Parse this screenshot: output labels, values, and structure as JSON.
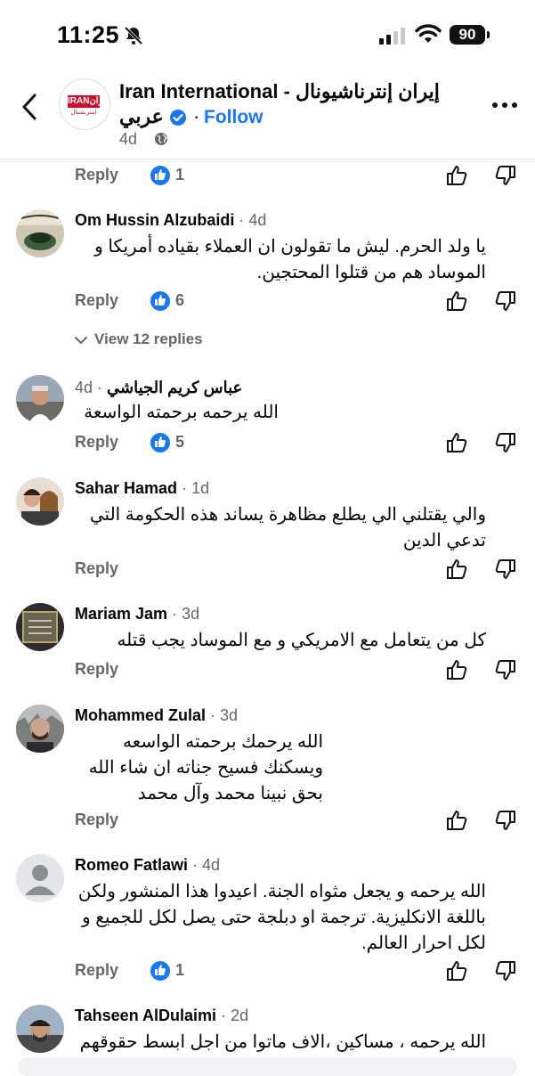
{
  "status_bar": {
    "time": "11:25",
    "battery": "90"
  },
  "header": {
    "page_name_line1": "Iran International - إيران إنترناشيونال",
    "page_name_line2": "عربي",
    "follow": "Follow",
    "separator": "·",
    "age": "4d",
    "logo_text": "IRANإيران",
    "logo_sub": "اینترنشنال"
  },
  "top_actions": {
    "reply": "Reply",
    "likes": "1"
  },
  "comments": [
    {
      "name": "Om Hussin Alzubaidi",
      "time": "4d",
      "lines": [
        "يا ولد الحرم. ليش ما تقولون ان العملاء بقياده أمريكا و",
        "الموساد هم من قتلوا المحتجين."
      ],
      "reply": "Reply",
      "likes": "6"
    },
    {
      "name": "عباس كريم الجياشي",
      "time": "4d",
      "lines": [
        "الله يرحمه برحمته الواسعة"
      ],
      "reply": "Reply",
      "likes": "5"
    },
    {
      "name": "Sahar Hamad",
      "time": "1d",
      "lines": [
        "والي يقتلني الي يطلع مظاهرة يساند هذه الحكومة التي",
        "تدعي الدين"
      ],
      "reply": "Reply",
      "likes": ""
    },
    {
      "name": "Mariam Jam",
      "time": "3d",
      "lines": [
        "كل من يتعامل مع الامريكي و مع الموساد يجب قتله"
      ],
      "reply": "Reply",
      "likes": ""
    },
    {
      "name": "Mohammed Zulal",
      "time": "3d",
      "lines": [
        "الله يرحمك برحمته الواسعه",
        "ويسكنك فسيح جناته ان شاء الله",
        "بحق نبينا محمد وآل محمد"
      ],
      "reply": "Reply",
      "likes": ""
    },
    {
      "name": "Romeo Fatlawi",
      "time": "4d",
      "lines": [
        "الله يرحمه و يجعل مثواه الجنة. اعيدوا هذا المنشور ولكن",
        "باللغة الانكليزية. ترجمة او دبلجة حتى يصل لكل للجميع و",
        "لكل احرار العالم."
      ],
      "reply": "Reply",
      "likes": "1"
    },
    {
      "name": "Tahseen AlDulaimi",
      "time": "2d",
      "lines": [
        "الله يرحمه ، مساكين ،الاف ماتوا من اجل ابسط حقوقهم"
      ],
      "reply": "",
      "likes": ""
    }
  ],
  "view_replies": "View 12 replies",
  "colors": {
    "accent": "#1877f2",
    "secondary_text": "#65676b",
    "logo_red": "#c8102e"
  }
}
